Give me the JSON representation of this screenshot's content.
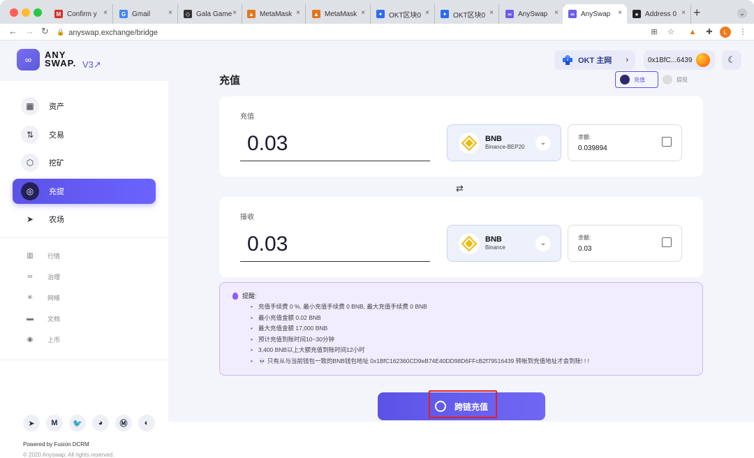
{
  "browser": {
    "tabs": [
      {
        "label": "Confirm y",
        "icon": "gmail-icon",
        "color": "#d93025",
        "glyph": "M"
      },
      {
        "label": "Gmail",
        "icon": "google-icon",
        "color": "#4285f4",
        "glyph": "G"
      },
      {
        "label": "Gala Game",
        "icon": "gala-icon",
        "color": "#333333",
        "glyph": "◇"
      },
      {
        "label": "MetaMask",
        "icon": "metamask-icon",
        "color": "#e2761b",
        "glyph": "▲"
      },
      {
        "label": "MetaMask",
        "icon": "metamask-icon",
        "color": "#e2761b",
        "glyph": "▲"
      },
      {
        "label": "OKT区块0",
        "icon": "okt-icon",
        "color": "#2d6bf0",
        "glyph": "✦"
      },
      {
        "label": "OKT区块0",
        "icon": "okt-icon",
        "color": "#2d6bf0",
        "glyph": "✦"
      },
      {
        "label": "AnySwap",
        "icon": "anyswap-icon",
        "color": "#6b5cf0",
        "glyph": "∞"
      },
      {
        "label": "AnySwap",
        "icon": "anyswap-icon",
        "color": "#6b5cf0",
        "glyph": "∞"
      },
      {
        "label": "Address 0",
        "icon": "avatar-icon",
        "color": "#222222",
        "glyph": "●"
      }
    ],
    "url": "anyswap.exchange/bridge"
  },
  "header": {
    "logo_line1": "ANY",
    "logo_line2": "SWAP.",
    "version": "V3↗",
    "network": "OKT 主网",
    "account": "0x1BfC...6439"
  },
  "sidebar": {
    "nav": [
      "资产",
      "交易",
      "挖矿",
      "充提",
      "农场"
    ],
    "sub": [
      "行情",
      "治理",
      "网络",
      "文档",
      "上币"
    ],
    "powered": "Powered by Fusion DCRM",
    "copyright": "© 2020 Anyswap. All rights reserved."
  },
  "main": {
    "title": "充值",
    "mode_tabs": [
      "充值",
      "提现"
    ],
    "deposit": {
      "label": "充值",
      "amount": "0.03",
      "token": "BNB",
      "chain": "Binance-BEP20",
      "balance_label": "余额:",
      "balance": "0.039894"
    },
    "receive": {
      "label": "接收",
      "amount": "0.03",
      "token": "BNB",
      "chain": "Binance",
      "balance_label": "余额:",
      "balance": "0.03"
    },
    "notice": {
      "title": "提醒:",
      "items": [
        "充值手续费 0 %, 最小充值手续费 0 BNB, 最大充值手续费 0 BNB",
        "最小充值金额 0.02 BNB",
        "最大充值金额 17,000 BNB",
        "预计充值到账时间10~30分钟",
        "3,400 BNB以上大额充值到账时间12小时",
        "💀 只有从与当前钱包一致的BNB钱包地址 0x1BfC162360CD9eB74E40DD98D6FFcB2f79516439 转帐到充值地址才会到账! ! !"
      ]
    },
    "submit": "跨链充值"
  },
  "colors": {
    "accent": "#5b53e6",
    "bnb": "#f0b90b",
    "notice_bg": "#f1ecff"
  }
}
